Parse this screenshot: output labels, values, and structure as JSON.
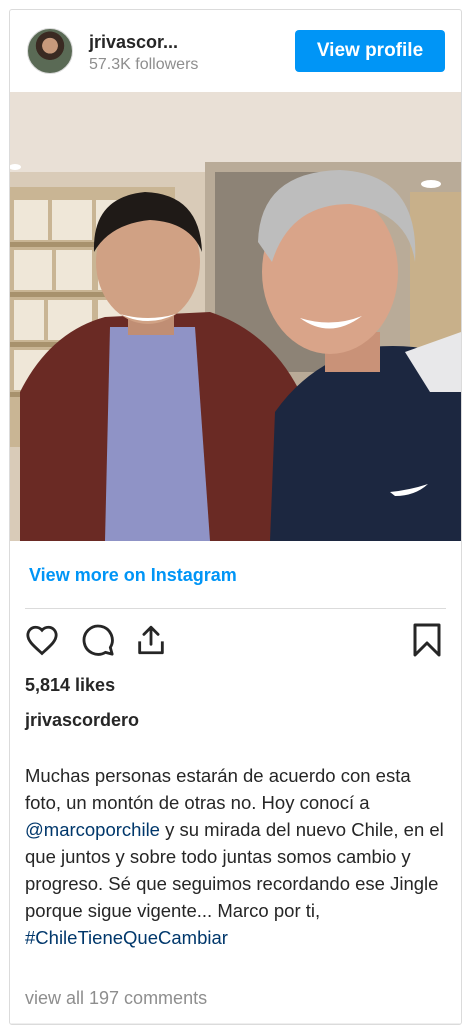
{
  "header": {
    "username": "jrivascor...",
    "followers": "57.3K followers",
    "view_profile_label": "View profile"
  },
  "post": {
    "view_more_label": "View more on Instagram",
    "likes": "5,814 likes",
    "owner": "jrivascordero",
    "caption": {
      "part1": "Muchas personas estarán de acuerdo con esta foto, un montón de otras no. Hoy conocí a ",
      "mention": "@marcoporchile",
      "part2": " y su mirada del nuevo Chile, en el que juntos y sobre todo juntas somos cambio y progreso. Sé que seguimos recordando ese Jingle porque sigue vigente... Marco por ti, ",
      "hashtag": "#ChileTieneQueCambiar"
    },
    "comments_label": "view all 197 comments"
  },
  "icons": {
    "like": "heart-icon",
    "comment": "comment-icon",
    "share": "share-icon",
    "save": "bookmark-icon"
  },
  "colors": {
    "accent": "#0095f6",
    "link": "#00376b",
    "muted": "#8e8e8e"
  }
}
